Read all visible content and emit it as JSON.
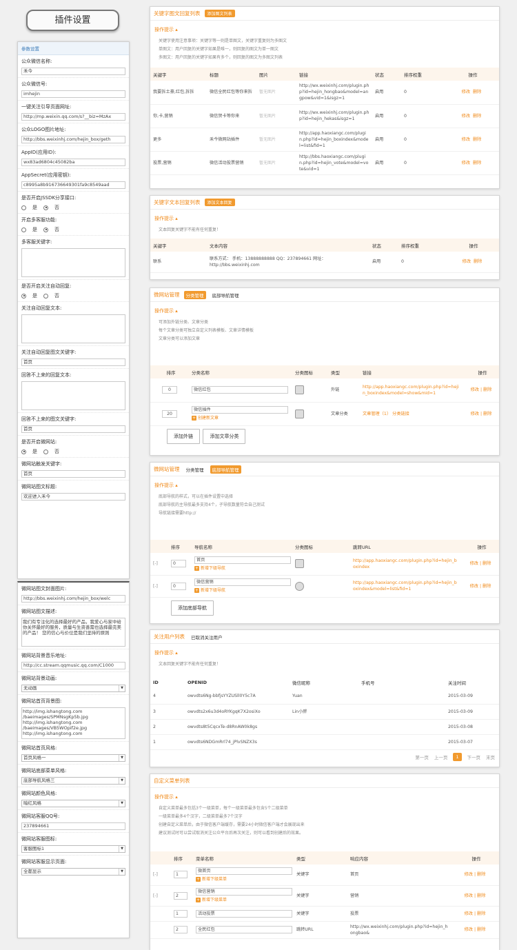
{
  "page_title": "插件设置",
  "left": {
    "section1": "参数设置",
    "fields": [
      {
        "label": "公众微信名称:",
        "value": "禾今"
      },
      {
        "label": "公众微信号:",
        "value": "imhejin"
      },
      {
        "label": "一键关注引导页面网址:",
        "value": "http://mp.weixin.qq.com/s?__biz=MzAx"
      },
      {
        "label": "公众LOGO图片地址:",
        "value": "http://bbs.weixinhj.com/hejin_box/geth"
      },
      {
        "label": "AppID(应用ID):",
        "value": "wx83ad6804c45082ba"
      },
      {
        "label": "AppSecret(应用密钥):",
        "value": "c8995a8b916736649301fa9c8549aad"
      }
    ],
    "jssdk": {
      "label": "是否开启JSSDK分享接口:",
      "opt_no": "是",
      "opt_yes": "否"
    },
    "multi": {
      "label": "开启多客服功能:",
      "opt_no": "是",
      "opt_yes": "否"
    },
    "multi_kw": {
      "label": "多客服关键字:"
    },
    "auto": {
      "label": "是否开启关注自动回复:",
      "opt_no": "是",
      "opt_yes": "否"
    },
    "auto_text": {
      "label": "关注自动回复文本:"
    },
    "auto_kw": {
      "label": "关注自动回复图文关键字:",
      "value": "首页"
    },
    "noreply_text": {
      "label": "回答不上来的回复文本:"
    },
    "noreply_kw": {
      "label": "回答不上来的图文关键字:",
      "value": "首页"
    },
    "site": {
      "label": "是否开启微网站:",
      "opt_yes": "是",
      "opt_no": "否"
    },
    "site_kw": {
      "label": "微网站触发关键字:",
      "value": "首页"
    },
    "site_title": {
      "label": "微网站图文标题:",
      "value": "欢迎进入禾今"
    },
    "cover": {
      "label": "微网站图文封面图片:",
      "value": "http://bbs.weixinhj.com/hejin_box/welc"
    },
    "desc": {
      "label": "微网站图文描述:",
      "value": "我们有专注化的选择最好的产品，我爱心与家中给你关怀最好的服务，质量与生资善需也选择最完美的产品！ 您的信心与价位是我们坚持的原则"
    },
    "music": {
      "label": "微网站背景音乐地址:",
      "value": "http://cc.stream.qqmusic.qq.com/C1000"
    },
    "bg_anim": {
      "label": "微网站背景动画:",
      "value": "无动画"
    },
    "home_bg": {
      "label": "微网站首页背景图:",
      "value": "http://img.ishangtong.com\n/baeimages/SPMNsgKp5b.jpg\nhttp://img.ishangtong.com\n/baeimages/VB5WOpif2e.jpg\nhttp://img.ishangtong.com"
    },
    "home_style": {
      "label": "微网站首页风格:",
      "value": "首页风格一"
    },
    "nav_style": {
      "label": "微网站底部菜单风格:",
      "value": "底部导航风格三"
    },
    "color_style": {
      "label": "微网站颜色风格:",
      "value": "暗红风格"
    },
    "qq": {
      "label": "微网站客服QQ号:",
      "value": "237894661"
    },
    "qq_icon": {
      "label": "微网站客服图标:",
      "value": "客服图标1"
    },
    "qq_show": {
      "label": "微网站客服显示页面:",
      "value": "全都显示"
    }
  },
  "p1": {
    "title": "关键字图文回复列表",
    "badge": "添加图文列表",
    "tip": "操作提示",
    "notes": [
      "关键字使用注意事项：关键字等一则是单图文，关键字重复则为多图文",
      "单图文：用户回复的关键字如果是唯一，则回复的图文为单一图文",
      "多图文：用户回复的关键字如果有多个，则回复的图文为多图文列表"
    ],
    "headers": [
      "关键字",
      "标题",
      "图片",
      "链接",
      "状态",
      "排序权重",
      "操作"
    ],
    "rows": [
      {
        "kw": "我要拆土豪,红包,拆拆",
        "title": "微信全民红包等你来拆",
        "link": "http://wx.weixinhj.com/plugin.php?id=hejin_hongbao&model=angpow&vid=1&isgz=1",
        "status": "启用",
        "sort": "0"
      },
      {
        "kw": "你,卡,营销",
        "title": "微信贺卡等你来",
        "link": "http://wx.weixinhj.com/plugin.php?id=hejin_hekas&isgz=1",
        "status": "启用",
        "sort": "0"
      },
      {
        "kw": "更多",
        "title": "禾今微网站插件",
        "link": "http://app.haoxiangc.com/plugin.php?id=hejin_boxindex&model=list&fid=1",
        "status": "启用",
        "sort": "0"
      },
      {
        "kw": "投票,营销",
        "title": "微信活动投票营销",
        "link": "http://bbs.haoxiangc.com/plugin.php?id=hejin_vote&model=vote&vid=1",
        "status": "启用",
        "sort": "0"
      }
    ],
    "img": "暂无图片",
    "op_edit": "修改",
    "op_del": "删除"
  },
  "p2": {
    "title": "关键字文本回复列表",
    "badge": "添加文本回复",
    "tip": "操作提示",
    "note": "文本回复关键字不能有任何重复！",
    "headers": [
      "关键字",
      "文本内容",
      "状态",
      "排序权重",
      "操作"
    ],
    "row": {
      "kw": "联系",
      "text": "联系方式： 手机：13888888888 QQ：237894661 网址：http://bbs.weixinhj.com",
      "status": "启用",
      "sort": "0"
    }
  },
  "p3": {
    "title": "微网站管理",
    "tab1": "分类管理",
    "tab2": "底部导航管理",
    "tip": "操作提示",
    "notes": [
      "可添加外链分类、文章分类",
      "每个文章分类可独立自定义列表模板、文章详情模板",
      "文章分类可以添加文章"
    ],
    "headers": [
      "排序",
      "分类名称",
      "分类图标",
      "类型",
      "链接",
      "操作"
    ],
    "rows": [
      {
        "sort": "0",
        "name": "微信红包",
        "type": "外链",
        "link": "http://app.haoxiangc.com/plugin.php?id=hejin_boxindex&model=show&mid=1",
        "op": "修改 | 删除"
      },
      {
        "sort": "20",
        "name": "微信插件",
        "sub": "创建新文章",
        "type": "文章分类",
        "link": "文章管理（1）  分类链接",
        "op": "修改 | 删除"
      }
    ],
    "btn1": "添加外链",
    "btn2": "添加文章分类"
  },
  "p4": {
    "title": "微网站管理",
    "tab1": "分类管理",
    "tab2": "底部导航管理",
    "tip": "操作提示",
    "notes": [
      "底部导航的样式，可以在插件设置中选择",
      "底部导航的主导航最多支持4个，子导航数量符合自己测试",
      "导航链接需要http://"
    ],
    "headers": [
      "",
      "排序",
      "导航名称",
      "分类图标",
      "跳转URL",
      "操作"
    ],
    "rows": [
      {
        "sort": "0",
        "name": "首页",
        "sub": "新增下级导航",
        "url": "http://app.haoxiangc.com/plugin.php?id=hejin_boxindex",
        "op": "修改 | 删除"
      },
      {
        "sort": "0",
        "name": "微信营销",
        "sub": "新增下级导航",
        "url": "http://app.haoxiangc.com/plugin.php?id=hejin_boxindex&model=list&fid=1",
        "op": "修改 | 删除"
      }
    ],
    "btn": "添加底部导航"
  },
  "p5": {
    "title": "关注用户列表",
    "tab2": "已取消关注用户",
    "tip": "操作提示",
    "note": "文本回复关键字不能有任何重复！",
    "headers": [
      "ID",
      "OPENID",
      "微信昵称",
      "手机号",
      "关注时间"
    ],
    "rows": [
      {
        "id": "4",
        "openid": "owvdts6Ng-bbfjsYYZUSll0Y5c7A",
        "nick": "Yuan",
        "phone": "",
        "time": "2015-03-09"
      },
      {
        "id": "3",
        "openid": "owvdts2x6u3d4oRYKgqK7X2osiXo",
        "nick": "Lin小胖",
        "phone": "",
        "time": "2015-03-09"
      },
      {
        "id": "2",
        "openid": "owvdts8t5CqcxTe-d8RnAW0k8gs",
        "nick": "",
        "phone": "",
        "time": "2015-03-08"
      },
      {
        "id": "1",
        "openid": "owvdts6NDGmRrl74_jPlvSNZX3s",
        "nick": "",
        "phone": "",
        "time": "2015-03-07"
      }
    ],
    "pager": {
      "first": "第一页",
      "prev": "上一页",
      "cur": "1",
      "next": "下一页",
      "last": "末页"
    }
  },
  "p6": {
    "title": "自定义菜单列表",
    "tip": "操作提示",
    "notes": [
      "自定义菜单最多包括3个一级菜单，每个一级菜单最多包含5个二级菜单",
      "一级菜单最多4个汉字，二级菜单最多7个汉字",
      "创建自定义菜单后，由于微信客户端缓存，需要24小时微信客户端才会展现出来",
      "建议测试时可以尝试取消关注公众平台后再次关注，则可以看到创建后的效果。"
    ],
    "headers": [
      "",
      "排序",
      "菜单名称",
      "类型",
      "响应内容",
      "操作"
    ],
    "rows": [
      {
        "sort": "1",
        "name": "微首页",
        "sub": "新增下级菜单",
        "type": "关键字",
        "resp": "首页",
        "op": "修改 | 删除"
      },
      {
        "sort": "2",
        "name": "微信营销",
        "sub": "新增下级菜单",
        "type": "关键字",
        "resp": "营销",
        "op": "修改 | 删除"
      },
      {
        "sort": "1",
        "name": "活动投票",
        "type": "关键字",
        "resp": "投票",
        "op": "修改 | 删除"
      },
      {
        "sort": "2",
        "name": "全民红包",
        "type": "跳转URL",
        "resp": "http://wx.weixinhj.com/plugin.php?id=hejin_hongbao&",
        "op": "修改 | 删除"
      }
    ]
  }
}
